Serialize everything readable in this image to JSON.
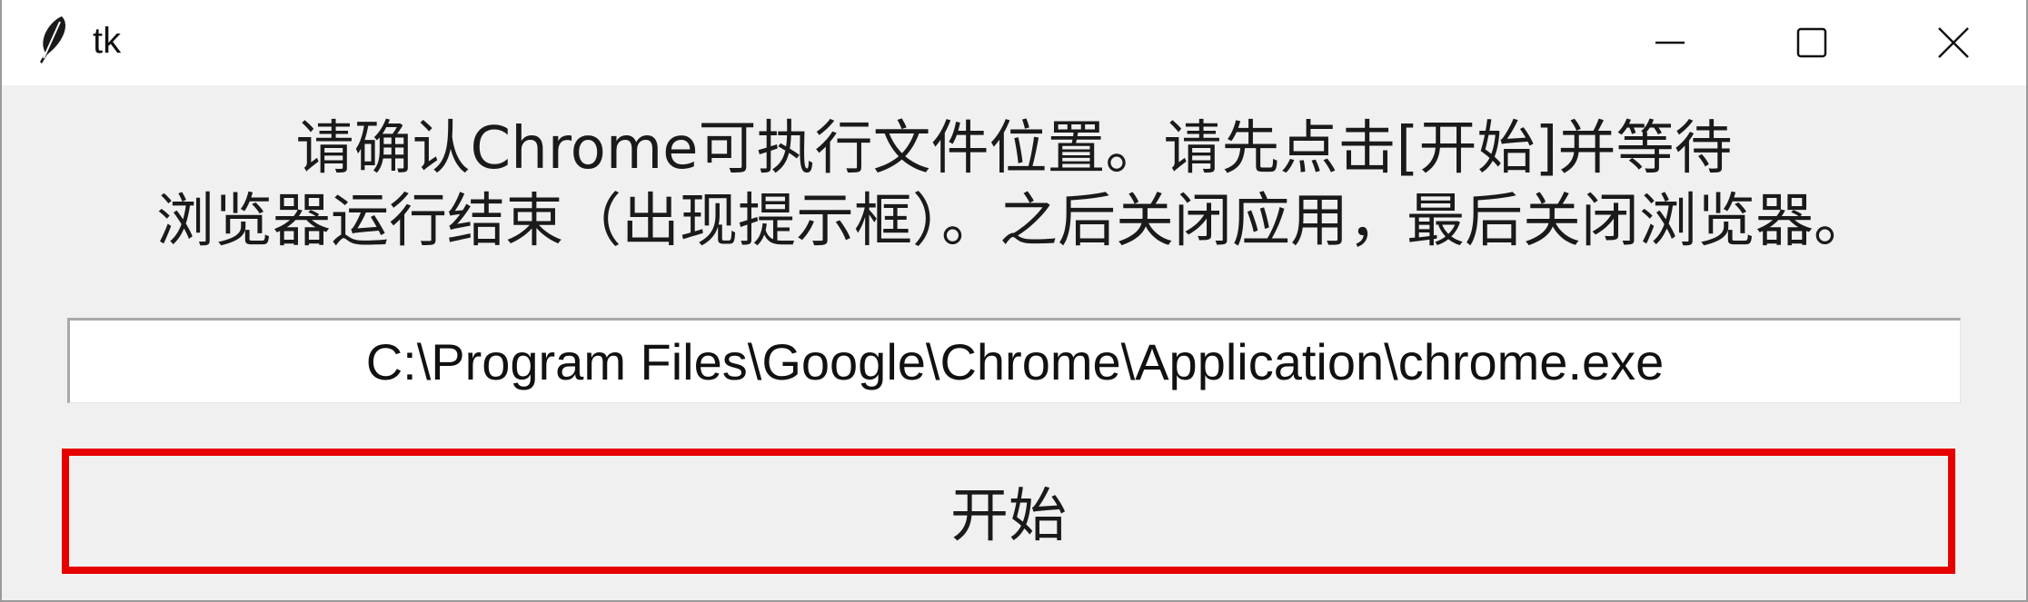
{
  "window": {
    "title": "tk",
    "app_icon": "feather-icon",
    "controls": {
      "minimize_icon": "minimize-icon",
      "maximize_icon": "maximize-icon",
      "close_icon": "close-icon"
    }
  },
  "instructions": {
    "line1": "请确认Chrome可执行文件位置。请先点击[开始]并等待",
    "line2": "浏览器运行结束（出现提示框）。之后关闭应用，最后关闭浏览器。"
  },
  "path_entry": {
    "value": "C:\\Program Files\\Google\\Chrome\\Application\\chrome.exe"
  },
  "start_button": {
    "label": "开始",
    "highlight_color": "#e60000"
  }
}
